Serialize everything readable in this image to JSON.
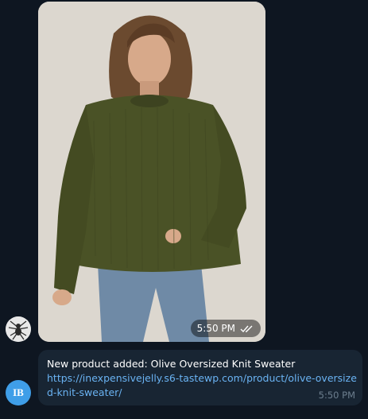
{
  "photo_message": {
    "image_icon": "photo-woman-olive-sweater",
    "time": "5:50 PM",
    "status_icon": "double-check-icon"
  },
  "avatars": {
    "bot_avatar_icon": "spider-avatar-icon",
    "user_initials": "IB"
  },
  "text_message": {
    "text": "New product added: Olive Oversized Knit Sweater",
    "link": "https://inexpensivejelly.s6-tastewp.com/product/olive-oversized-knit-sweater/",
    "time": "5:50 PM"
  },
  "colors": {
    "background": "#0e1621",
    "bubble": "#182533",
    "link": "#6ab3f3",
    "avatar_ib": "#3f9ee8",
    "sweater": "#4a5226"
  }
}
